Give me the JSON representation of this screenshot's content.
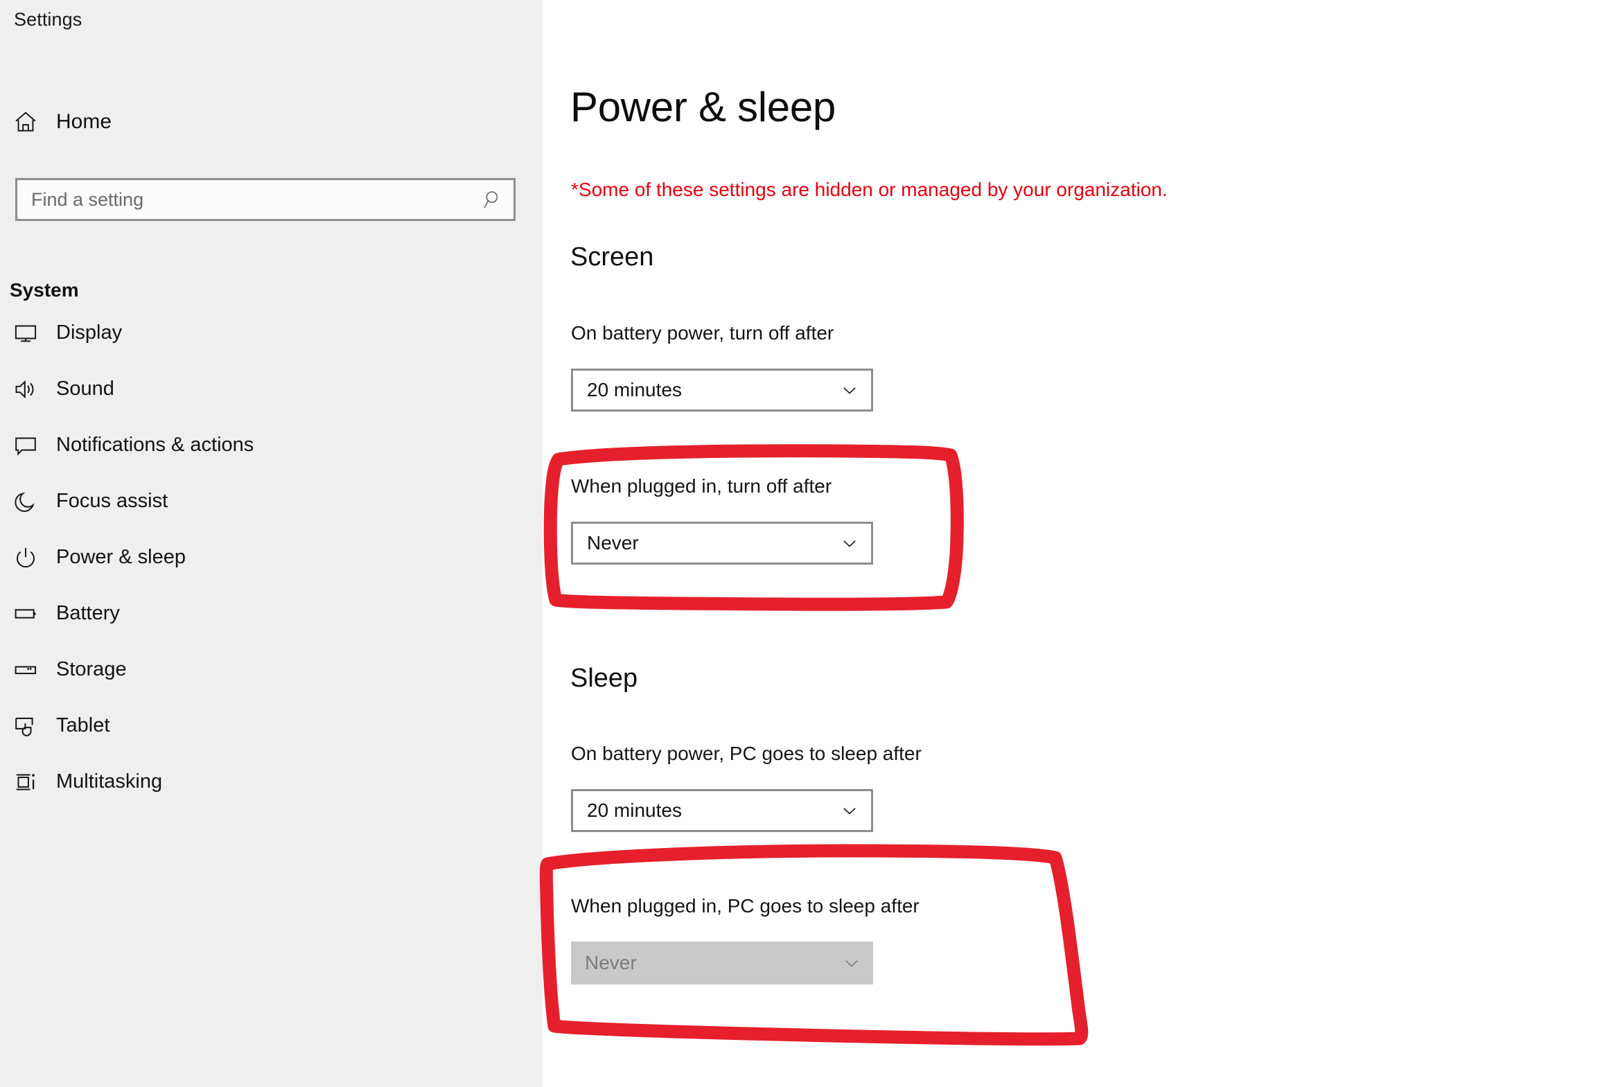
{
  "sidebar": {
    "app_title": "Settings",
    "home": {
      "label": "Home",
      "icon": "home-icon"
    },
    "search": {
      "placeholder": "Find a setting",
      "value": "",
      "icon": "search-icon"
    },
    "section_header": "System",
    "items": [
      {
        "label": "Display",
        "icon": "monitor-icon"
      },
      {
        "label": "Sound",
        "icon": "speaker-icon"
      },
      {
        "label": "Notifications & actions",
        "icon": "chat-bubble-icon"
      },
      {
        "label": "Focus assist",
        "icon": "moon-icon"
      },
      {
        "label": "Power & sleep",
        "icon": "power-icon"
      },
      {
        "label": "Battery",
        "icon": "battery-icon"
      },
      {
        "label": "Storage",
        "icon": "storage-icon"
      },
      {
        "label": "Tablet",
        "icon": "tablet-touch-icon"
      },
      {
        "label": "Multitasking",
        "icon": "multitasking-icon"
      }
    ]
  },
  "main": {
    "page_title": "Power & sleep",
    "org_notice": "*Some of these settings are hidden or managed by your organization.",
    "notice_color": "#e3000f",
    "annotation_color": "#e5202c",
    "groups": [
      {
        "heading": "Screen",
        "fields": [
          {
            "label": "On battery power, turn off after",
            "value": "20 minutes",
            "disabled": false,
            "annotated": false,
            "chevron": "chevron-down-icon"
          },
          {
            "label": "When plugged in, turn off after",
            "value": "Never",
            "disabled": false,
            "annotated": true,
            "chevron": "chevron-down-icon"
          }
        ]
      },
      {
        "heading": "Sleep",
        "fields": [
          {
            "label": "On battery power, PC goes to sleep after",
            "value": "20 minutes",
            "disabled": false,
            "annotated": false,
            "chevron": "chevron-down-icon"
          },
          {
            "label": "When plugged in, PC goes to sleep after",
            "value": "Never",
            "disabled": true,
            "annotated": true,
            "chevron": "chevron-down-icon"
          }
        ]
      }
    ]
  }
}
